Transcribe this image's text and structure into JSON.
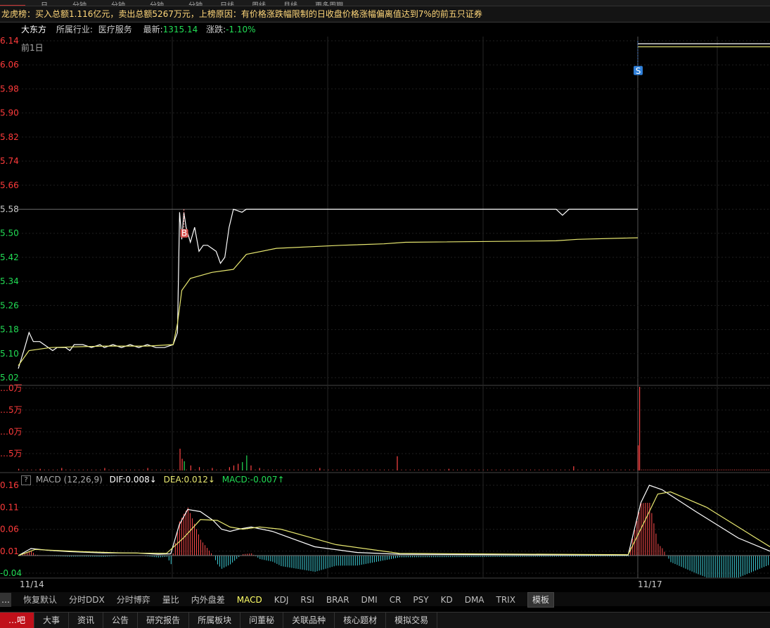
{
  "top_tabs": [
    {
      "label": "…",
      "active": true
    },
    {
      "label": "…日"
    },
    {
      "label": "…分钟"
    },
    {
      "label": "…分钟"
    },
    {
      "label": "…分钟"
    },
    {
      "label": "…分钟"
    },
    {
      "label": "日线"
    },
    {
      "label": "周线"
    },
    {
      "label": "月线"
    },
    {
      "label": "更多周期"
    }
  ],
  "notice": "龙虎榜：买入总额1.116亿元，卖出总额5267万元，上榜原因：有价格涨跌幅限制的日收盘价格涨幅偏离值达到7%的前五只证券",
  "stock": {
    "name": "大东方",
    "industry_label": "所属行业:",
    "industry": "医疗服务",
    "latest_label": "最新:",
    "latest": "1315.14",
    "change_label": "涨跌:",
    "change": "-1.10%"
  },
  "chart_label": "前1日",
  "price_axis": [
    "6.14",
    "6.06",
    "5.98",
    "5.90",
    "5.82",
    "5.74",
    "5.66",
    "5.58",
    "5.50",
    "5.42",
    "5.34",
    "5.26",
    "5.18",
    "5.10",
    "5.02"
  ],
  "volume_axis": [
    "…0万",
    "…5万",
    "…0万",
    "…5万"
  ],
  "macd_axis": [
    "0.16",
    "0.11",
    "0.06",
    "0.01",
    "-0.04"
  ],
  "date_labels": [
    "11/14",
    "11/17"
  ],
  "macd_header": {
    "help": "?",
    "name": "MACD (12,26,9)",
    "dif": "DIF:0.008↓",
    "dea": "DEA:0.012↓",
    "macd": "MACD:-0.007↑"
  },
  "markers": {
    "buy": "B",
    "sell": "S"
  },
  "indicators": [
    "…",
    "恢复默认",
    "分时DDX",
    "分时博弈",
    "量比",
    "内外盘差",
    "MACD",
    "KDJ",
    "RSI",
    "BRAR",
    "DMI",
    "CR",
    "PSY",
    "KD",
    "DMA",
    "TRIX",
    "模板"
  ],
  "active_indicator": "MACD",
  "bottom_tabs": [
    "…吧",
    "大事",
    "资讯",
    "公告",
    "研究报告",
    "所属板块",
    "问董秘",
    "关联品种",
    "核心题材",
    "模拟交易"
  ],
  "colors": {
    "up": "#ff3b3b",
    "down": "#22dd55",
    "price_line": "#ffffff",
    "avg_line": "#e8e870",
    "macd_neg": "#3fcfd8",
    "accent": "#c0101a"
  },
  "chart_data": {
    "type": "line",
    "price_range": [
      5.02,
      6.14
    ],
    "reference_close": 5.58,
    "series": [
      {
        "name": "price",
        "points": [
          [
            0,
            5.05
          ],
          [
            3,
            5.12
          ],
          [
            5,
            5.17
          ],
          [
            7,
            5.14
          ],
          [
            10,
            5.14
          ],
          [
            14,
            5.12
          ],
          [
            16,
            5.11
          ],
          [
            18,
            5.12
          ],
          [
            22,
            5.12
          ],
          [
            24,
            5.11
          ],
          [
            26,
            5.13
          ],
          [
            30,
            5.13
          ],
          [
            34,
            5.12
          ],
          [
            38,
            5.13
          ],
          [
            40,
            5.12
          ],
          [
            44,
            5.13
          ],
          [
            48,
            5.12
          ],
          [
            52,
            5.13
          ],
          [
            56,
            5.12
          ],
          [
            60,
            5.13
          ],
          [
            64,
            5.12
          ],
          [
            68,
            5.12
          ],
          [
            72,
            5.13
          ],
          [
            74,
            5.17
          ],
          [
            75,
            5.57
          ],
          [
            76,
            5.48
          ],
          [
            77,
            5.57
          ],
          [
            78,
            5.52
          ],
          [
            80,
            5.47
          ],
          [
            82,
            5.52
          ],
          [
            84,
            5.44
          ],
          [
            86,
            5.46
          ],
          [
            88,
            5.46
          ],
          [
            90,
            5.45
          ],
          [
            92,
            5.44
          ],
          [
            94,
            5.4
          ],
          [
            96,
            5.42
          ],
          [
            98,
            5.52
          ],
          [
            100,
            5.58
          ],
          [
            104,
            5.57
          ],
          [
            106,
            5.58
          ],
          [
            140,
            5.58
          ],
          [
            170,
            5.58
          ],
          [
            200,
            5.58
          ],
          [
            250,
            5.58
          ],
          [
            253,
            5.56
          ],
          [
            256,
            5.58
          ],
          [
            288,
            5.58
          ]
        ]
      },
      {
        "name": "avg",
        "points": [
          [
            0,
            5.06
          ],
          [
            5,
            5.11
          ],
          [
            15,
            5.12
          ],
          [
            40,
            5.125
          ],
          [
            60,
            5.125
          ],
          [
            72,
            5.13
          ],
          [
            74,
            5.2
          ],
          [
            76,
            5.31
          ],
          [
            80,
            5.35
          ],
          [
            90,
            5.37
          ],
          [
            100,
            5.38
          ],
          [
            106,
            5.43
          ],
          [
            120,
            5.45
          ],
          [
            150,
            5.46
          ],
          [
            170,
            5.465
          ],
          [
            180,
            5.47
          ],
          [
            250,
            5.475
          ],
          [
            260,
            5.48
          ],
          [
            288,
            5.485
          ]
        ]
      }
    ],
    "volume_bars": [
      [
        0,
        0.2
      ],
      [
        10,
        0.2
      ],
      [
        20,
        0.3
      ],
      [
        40,
        0.3
      ],
      [
        60,
        0.3
      ],
      [
        75,
        2.6
      ],
      [
        76,
        1.4
      ],
      [
        77,
        1.1
      ],
      [
        80,
        0.6
      ],
      [
        84,
        0.4
      ],
      [
        90,
        0.3
      ],
      [
        98,
        0.4
      ],
      [
        100,
        0.6
      ],
      [
        102,
        0.8
      ],
      [
        104,
        1.0
      ],
      [
        106,
        1.8
      ],
      [
        108,
        0.6
      ],
      [
        112,
        0.3
      ],
      [
        140,
        0.3
      ],
      [
        176,
        1.7
      ],
      [
        200,
        0.2
      ],
      [
        258,
        0.5
      ],
      [
        288,
        3.0
      ],
      [
        289,
        10.0
      ]
    ],
    "next_day": {
      "price": 6.13,
      "avg": 6.12
    },
    "macd": {
      "range": [
        -0.04,
        0.16
      ],
      "dif": [
        [
          0,
          0.0
        ],
        [
          6,
          0.016
        ],
        [
          14,
          0.012
        ],
        [
          24,
          0.009
        ],
        [
          40,
          0.006
        ],
        [
          56,
          0.006
        ],
        [
          66,
          0.003
        ],
        [
          72,
          0.004
        ],
        [
          76,
          0.07
        ],
        [
          80,
          0.105
        ],
        [
          86,
          0.1
        ],
        [
          92,
          0.08
        ],
        [
          96,
          0.06
        ],
        [
          100,
          0.055
        ],
        [
          104,
          0.06
        ],
        [
          110,
          0.065
        ],
        [
          120,
          0.055
        ],
        [
          140,
          0.02
        ],
        [
          160,
          0.007
        ],
        [
          180,
          0.003
        ],
        [
          288,
          0.001
        ],
        [
          294,
          0.12
        ],
        [
          298,
          0.16
        ],
        [
          304,
          0.15
        ],
        [
          320,
          0.1
        ],
        [
          340,
          0.04
        ],
        [
          355,
          0.01
        ]
      ],
      "dea": [
        [
          0,
          0.0
        ],
        [
          8,
          0.014
        ],
        [
          16,
          0.012
        ],
        [
          30,
          0.009
        ],
        [
          50,
          0.006
        ],
        [
          70,
          0.005
        ],
        [
          78,
          0.04
        ],
        [
          86,
          0.082
        ],
        [
          94,
          0.08
        ],
        [
          100,
          0.065
        ],
        [
          106,
          0.06
        ],
        [
          114,
          0.065
        ],
        [
          124,
          0.06
        ],
        [
          150,
          0.025
        ],
        [
          180,
          0.005
        ],
        [
          288,
          0.002
        ],
        [
          296,
          0.08
        ],
        [
          302,
          0.14
        ],
        [
          308,
          0.145
        ],
        [
          325,
          0.11
        ],
        [
          345,
          0.05
        ],
        [
          355,
          0.02
        ]
      ]
    }
  }
}
